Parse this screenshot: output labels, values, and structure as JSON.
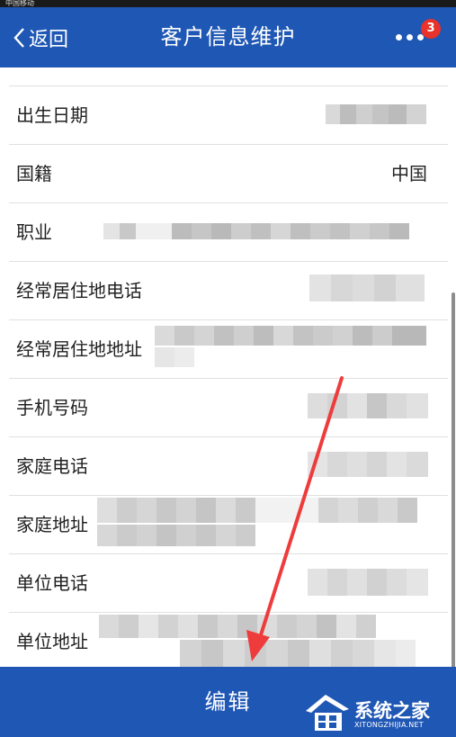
{
  "status_bar": {
    "text": "中国移动"
  },
  "nav": {
    "back_label": "返回",
    "title": "客户信息维护",
    "badge_count": "3"
  },
  "rows": [
    {
      "label": "出生日期",
      "value": ""
    },
    {
      "label": "国籍",
      "value": "中国"
    },
    {
      "label": "职业",
      "value": ""
    },
    {
      "label": "经常居住地电话",
      "value": ""
    },
    {
      "label": "经常居住地地址",
      "value": ""
    },
    {
      "label": "手机号码",
      "value": ""
    },
    {
      "label": "家庭电话",
      "value": ""
    },
    {
      "label": "家庭地址",
      "value": ""
    },
    {
      "label": "单位电话",
      "value": ""
    },
    {
      "label": "单位地址",
      "value": ""
    }
  ],
  "footer": {
    "edit_label": "编辑"
  },
  "watermark": {
    "name": "系统之家",
    "url": "XITONGZHIJIA.NET"
  },
  "colors": {
    "navbar": "#1f57b5",
    "badge": "#e8322a",
    "arrow": "#ee3b3b"
  }
}
